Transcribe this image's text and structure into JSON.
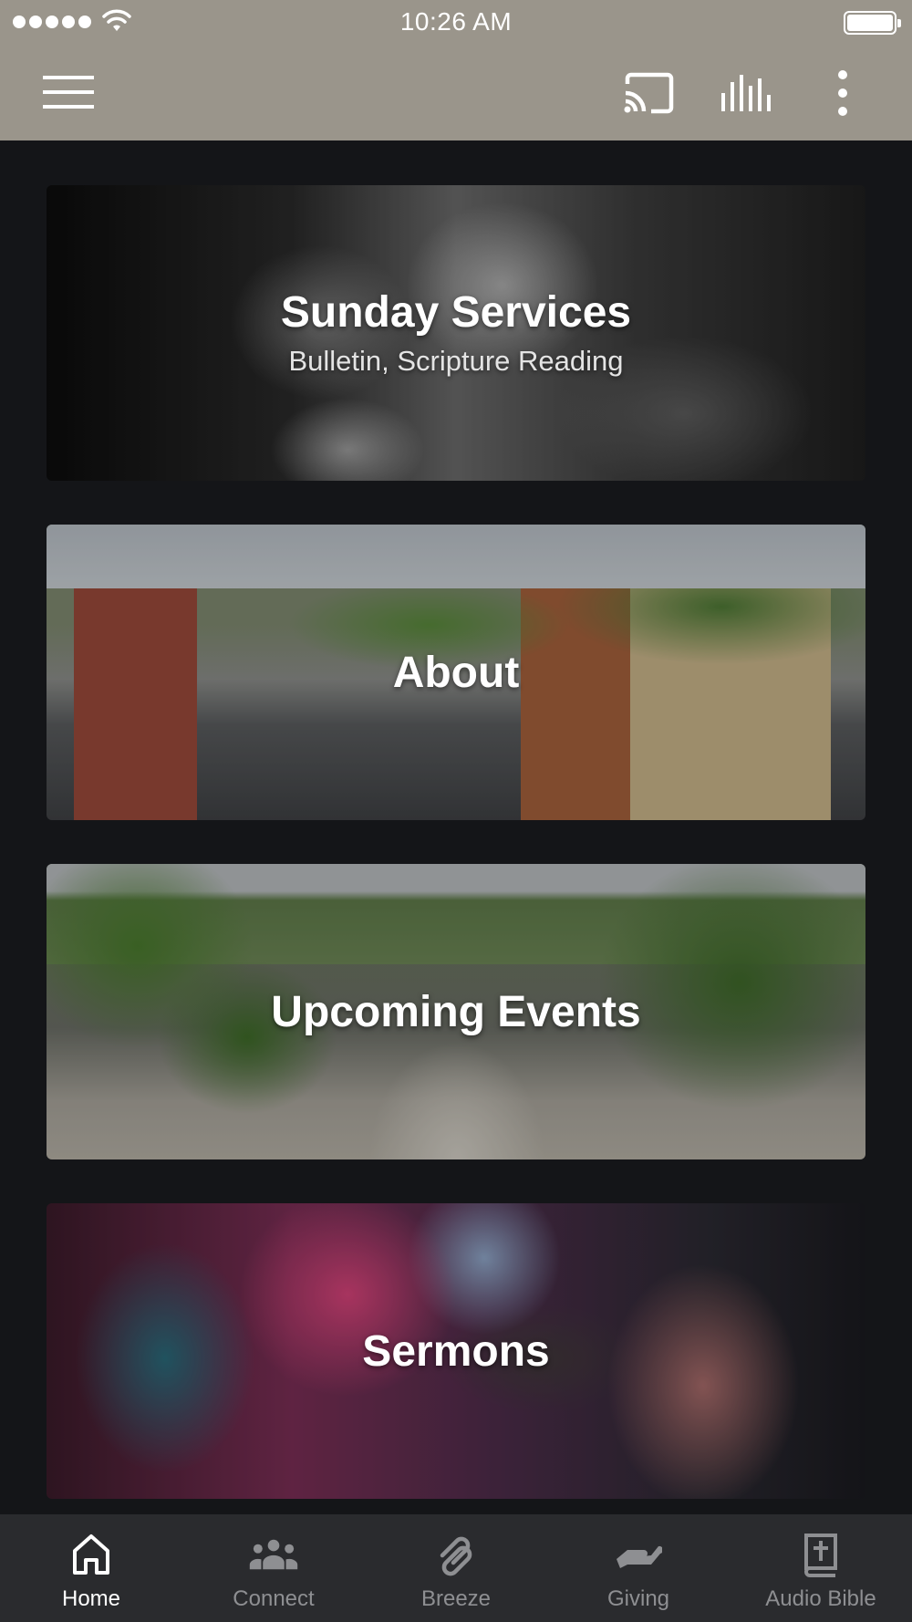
{
  "status_bar": {
    "time": "10:26 AM",
    "signal_icon": "signal-dots-icon",
    "wifi_icon": "wifi-icon",
    "battery_icon": "battery-full-icon"
  },
  "toolbar": {
    "menu_icon": "hamburger-menu-icon",
    "cast_icon": "cast-icon",
    "audio_icon": "audio-bars-icon",
    "more_icon": "more-vertical-icon",
    "background_color": "#9a958b"
  },
  "cards": [
    {
      "id": "sunday-services",
      "title": "Sunday Services",
      "subtitle": "Bulletin, Scripture Reading"
    },
    {
      "id": "about",
      "title": "About"
    },
    {
      "id": "upcoming-events",
      "title": "Upcoming Events"
    },
    {
      "id": "sermons",
      "title": "Sermons"
    }
  ],
  "tabs": [
    {
      "label": "Home",
      "icon": "home-icon",
      "active": true
    },
    {
      "label": "Connect",
      "icon": "people-group-icon",
      "active": false
    },
    {
      "label": "Breeze",
      "icon": "breeze-logo-icon",
      "active": false
    },
    {
      "label": "Giving",
      "icon": "giving-hand-icon",
      "active": false
    },
    {
      "label": "Audio Bible",
      "icon": "bible-book-icon",
      "active": false
    }
  ],
  "colors": {
    "page_background": "#141518",
    "tabbar_background": "#2a2b2e",
    "tab_active": "#ffffff",
    "tab_inactive": "#8e8f92"
  }
}
